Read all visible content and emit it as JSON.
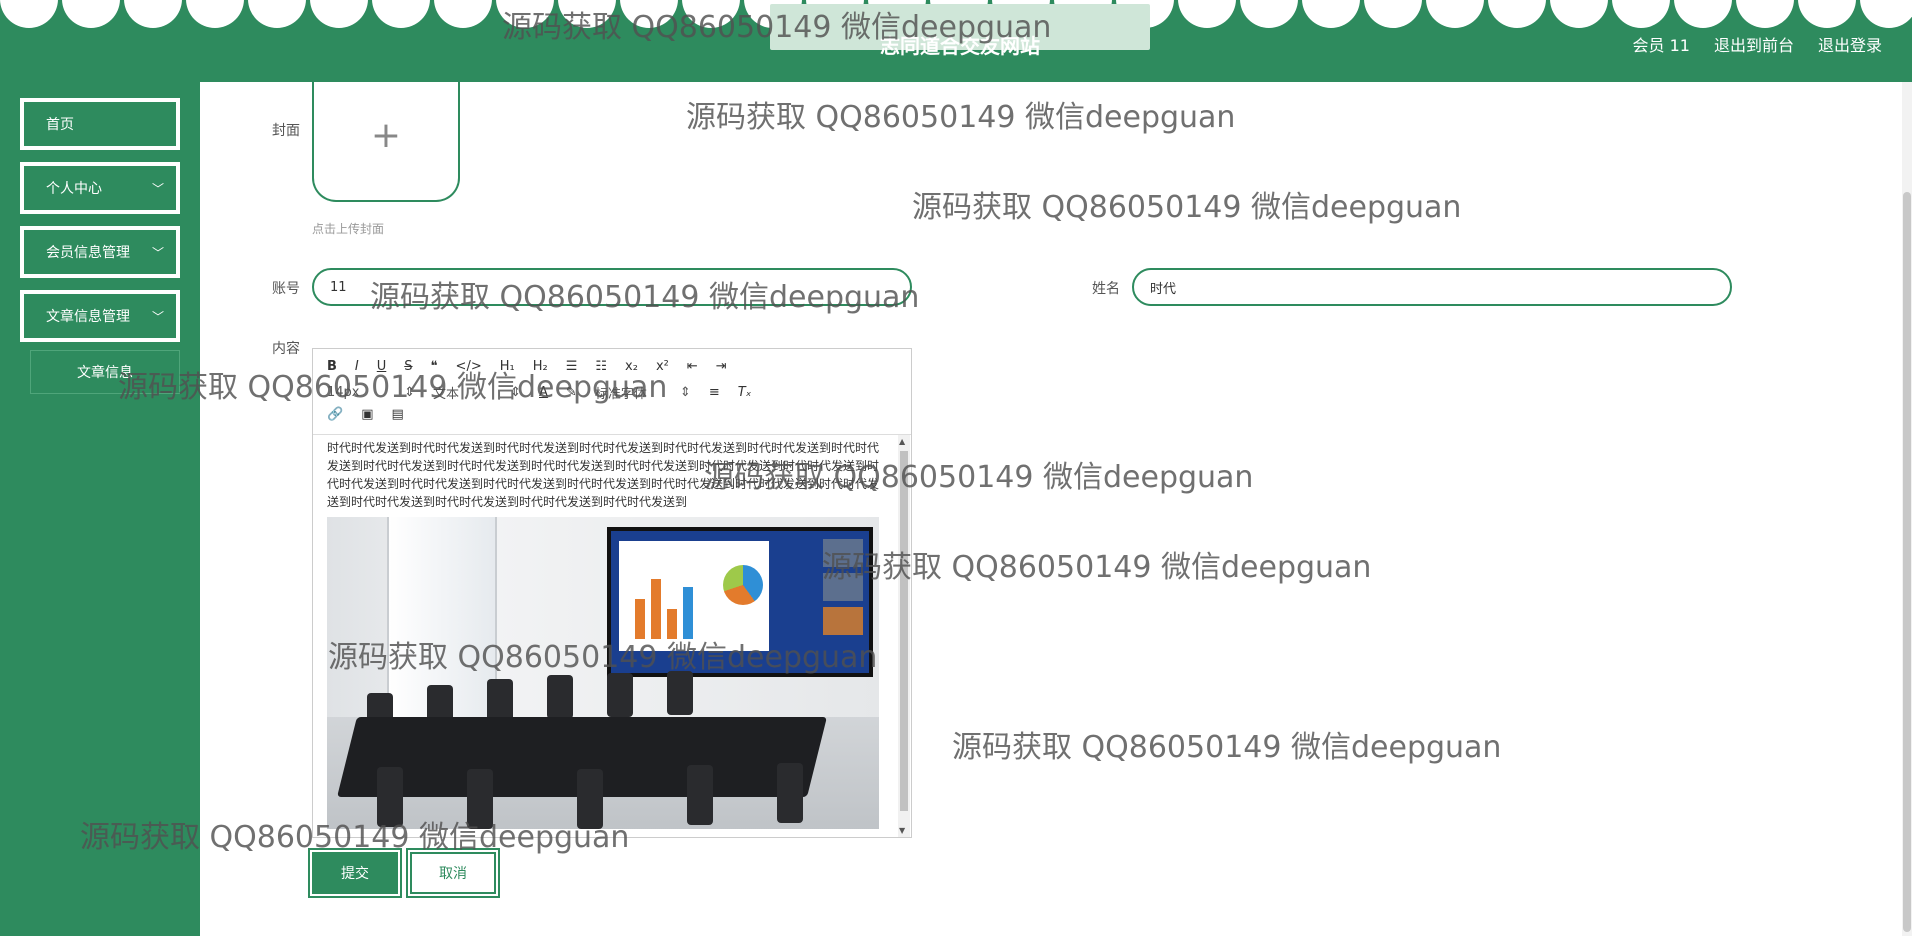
{
  "header": {
    "site_title": "志同道合交友网站",
    "member": "会员 11",
    "exit_front": "退出到前台",
    "logout": "退出登录"
  },
  "sidebar": {
    "items": [
      {
        "label": "首页"
      },
      {
        "label": "个人中心"
      },
      {
        "label": "会员信息管理"
      },
      {
        "label": "文章信息管理"
      }
    ],
    "sub_item": "文章信息"
  },
  "form": {
    "cover_label": "封面",
    "upload_hint": "点击上传封面",
    "account_label": "账号",
    "account_value": "11",
    "name_label": "姓名",
    "name_value": "时代",
    "content_label": "内容"
  },
  "editor": {
    "font_size": "14px",
    "block_type": "文本",
    "font_family": "标准字体",
    "text": "时代时代发送到时代时代发送到时代时代发送到时代时代发送到时代时代发送到时代时代发送到时代时代发送到时代时代发送到时代时代发送到时代时代发送到时代时代发送到时代时代发送到时代时代发送到时代时代发送到时代时代发送到时代时代发送到时代时代发送到时代时代发送到时代时代发送到时代时代发送到时代时代发送到时代时代发送到时代时代发送到时代时代发送到"
  },
  "buttons": {
    "submit": "提交",
    "cancel": "取消"
  },
  "watermark": "源码获取 QQ86050149 微信deepguan"
}
